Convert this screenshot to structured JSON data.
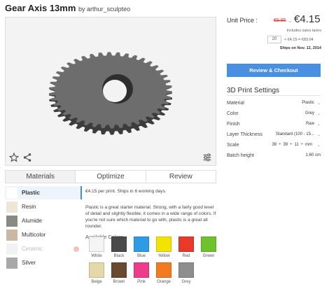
{
  "header": {
    "title": "Gear Axis 13mm",
    "by": "by arthur_sculpteo"
  },
  "viewer": {
    "icons": [
      "star-icon",
      "share-icon",
      "settings-sliders-icon"
    ]
  },
  "tabs": [
    {
      "label": "Materials",
      "active": true
    },
    {
      "label": "Optimize",
      "active": false
    },
    {
      "label": "Review",
      "active": false
    }
  ],
  "materials": [
    {
      "label": "Plastic",
      "swatch": "#ffffff",
      "active": true,
      "disabled": false
    },
    {
      "label": "Resin",
      "swatch": "#eee6d6",
      "active": false,
      "disabled": false
    },
    {
      "label": "Alumide",
      "swatch": "#8a8a82",
      "active": false,
      "disabled": false
    },
    {
      "label": "Multicolor",
      "swatch": "#c9b8a2",
      "active": false,
      "disabled": false
    },
    {
      "label": "Ceramic",
      "swatch": "#f2f2f2",
      "active": false,
      "disabled": true
    },
    {
      "label": "Silver",
      "swatch": "#a8a8a8",
      "active": false,
      "disabled": false
    }
  ],
  "description": {
    "price_line": "€4.15 per print. Ships in 6 working days.",
    "paragraph": "Plastic is a great starter material. Strong, with a fairly good level of detail and slightly flexible, it comes in a wide range of colors. If you're not sure which material to go with, plastic is a great all rounder.",
    "available_colors_label": "Available Colors"
  },
  "colors": [
    {
      "name": "White",
      "hex": "#f4f4f4"
    },
    {
      "name": "Black",
      "hex": "#4a4a4a"
    },
    {
      "name": "Blue",
      "hex": "#2e9be6"
    },
    {
      "name": "Yellow",
      "hex": "#f2e400"
    },
    {
      "name": "Red",
      "hex": "#e8392b"
    },
    {
      "name": "Green",
      "hex": "#6fc22b"
    },
    {
      "name": "Beige",
      "hex": "#e4d7a8"
    },
    {
      "name": "Brown",
      "hex": "#6b4a32"
    },
    {
      "name": "Pink",
      "hex": "#ee3b8b"
    },
    {
      "name": "Orange",
      "hex": "#f37a1f"
    },
    {
      "name": "Grey",
      "hex": "#8e8e8e"
    }
  ],
  "pricing": {
    "unit_price_label": "Unit Price :",
    "old_price": "€9.95",
    "price": "€4.15",
    "tax_note": "Includes sales taxes",
    "quantity": "20",
    "total": "× €4.15 = €83.04",
    "ships": "Ships on Nov. 12, 2014",
    "cta": "Review & Checkout"
  },
  "settings": {
    "title": "3D Print Settings",
    "material": {
      "label": "Material",
      "value": "Plastic"
    },
    "color": {
      "label": "Color",
      "value": "Grey"
    },
    "finish": {
      "label": "Finish",
      "value": "Raw"
    },
    "layer": {
      "label": "Layer Thickness",
      "value": "Standard (100 - 15..."
    },
    "scale": {
      "label": "Scale",
      "x": "39",
      "y": "39",
      "z": "11",
      "unit": "mm"
    },
    "batch": {
      "label": "Batch height",
      "value": "1.60 cm"
    }
  },
  "colors_meta": {
    "accent": "#4a90e2",
    "strike": "#dd3333"
  }
}
